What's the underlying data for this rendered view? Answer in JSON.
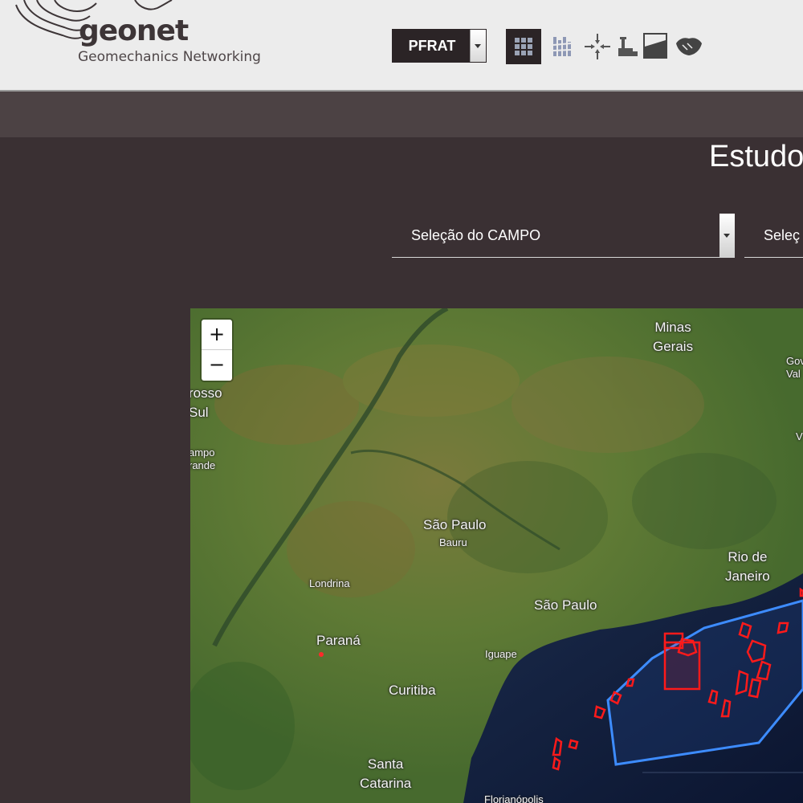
{
  "header": {
    "logo_word": "geonet",
    "logo_tagline": "Geomechanics Networking",
    "project_selector": {
      "value": "PFRAT"
    },
    "tools": [
      {
        "name": "grid-view-icon",
        "active": true
      },
      {
        "name": "well-logs-icon",
        "active": false
      },
      {
        "name": "compression-icon",
        "active": false
      },
      {
        "name": "drilling-rig-icon",
        "active": false
      },
      {
        "name": "tank-level-icon",
        "active": false
      },
      {
        "name": "handshake-icon",
        "active": false
      }
    ]
  },
  "main": {
    "title": "Estudos",
    "field_select": {
      "value": "Seleção do CAMPO"
    },
    "second_select": {
      "value": "Seleç"
    }
  },
  "map": {
    "zoom_in": "+",
    "zoom_out": "−",
    "labels": {
      "minas_gerais": "Minas\nGerais",
      "gov_val": "Gov\nVal",
      "v": "V",
      "mato_grosso_sul": "rosso\nSul",
      "campo_grande": "ampo\nrande",
      "sao_paulo_state": "São Paulo",
      "bauru": "Bauru",
      "londrina": "Londrina",
      "rio_de_janeiro": "Rio de\nJaneiro",
      "sao_paulo_city": "São Paulo",
      "parana": "Paraná",
      "iguape": "Iguape",
      "curitiba": "Curitiba",
      "santa_catarina": "Santa\nCatarina",
      "florianopolis": "Florianópolis"
    }
  },
  "colors": {
    "header_bg": "#ececec",
    "page_bg": "#3a3033",
    "subbar_bg": "#4c4244",
    "basin_outline": "#3d8cff",
    "field_outline": "#ff1a1a"
  }
}
